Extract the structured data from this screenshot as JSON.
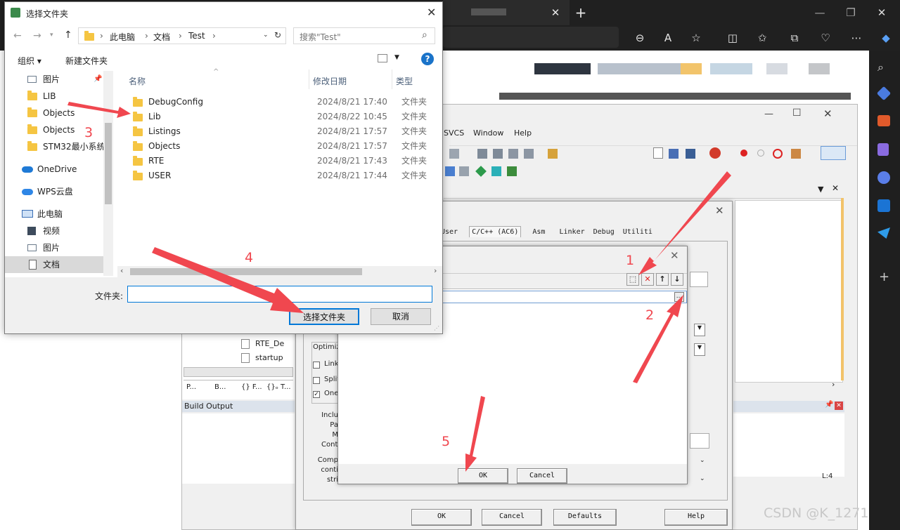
{
  "browser": {
    "icons": [
      "zoom-out-icon",
      "read-aloud-icon",
      "favorite-star-icon",
      "split-screen-icon",
      "favorites-icon",
      "collections-icon",
      "performance-icon",
      "more-icon",
      "copilot-icon"
    ],
    "tab_close": "✕",
    "new_tab": "+",
    "win_min": "—",
    "win_max": "❐",
    "win_close": "✕"
  },
  "keil": {
    "menu": [
      "SVCS",
      "Window",
      "Help"
    ],
    "build_output_title": "Build Output",
    "files": [
      "RTE_De",
      "startup"
    ],
    "panel_tabs": [
      "P...",
      "B...",
      "{} F...",
      "{}ₒ T..."
    ],
    "options_tabs": [
      "User",
      "C/C++ (AC6)",
      "Asm",
      "Linker",
      "Debug",
      "Utiliti"
    ],
    "optimize_label": "Optimiz",
    "check_link": "Link",
    "check_split": "Split",
    "check_one": "One",
    "include_labels": [
      "Inclu",
      "Pa",
      "M",
      "Contr"
    ],
    "compiler_labels": [
      "Comp",
      "conti",
      "stri"
    ],
    "buttons": {
      "ok": "OK",
      "cancel": "Cancel",
      "defaults": "Defaults",
      "help": "Help"
    },
    "status_text": "L:4"
  },
  "include_dialog": {
    "ok": "OK",
    "cancel": "Cancel",
    "browse": "..."
  },
  "file_dialog": {
    "title": "选择文件夹",
    "breadcrumb": [
      "此电脑",
      "文档",
      "Test"
    ],
    "search_placeholder": "搜索\"Test\"",
    "toolbar": {
      "organize": "组织 ▾",
      "new_folder": "新建文件夹"
    },
    "sidebar": [
      {
        "label": "图片"
      },
      {
        "label": "LIB"
      },
      {
        "label": "Objects"
      },
      {
        "label": "Objects"
      },
      {
        "label": "STM32最小系统"
      },
      {
        "label": "OneDrive"
      },
      {
        "label": "WPS云盘"
      },
      {
        "label": "此电脑"
      },
      {
        "label": "视频"
      },
      {
        "label": "图片"
      },
      {
        "label": "文档"
      }
    ],
    "columns": {
      "name": "名称",
      "date": "修改日期",
      "type": "类型"
    },
    "files": [
      {
        "name": "DebugConfig",
        "date": "2024/8/21 17:40",
        "type": "文件夹"
      },
      {
        "name": "Lib",
        "date": "2024/8/22 10:45",
        "type": "文件夹"
      },
      {
        "name": "Listings",
        "date": "2024/8/21 17:57",
        "type": "文件夹"
      },
      {
        "name": "Objects",
        "date": "2024/8/21 17:57",
        "type": "文件夹"
      },
      {
        "name": "RTE",
        "date": "2024/8/21 17:43",
        "type": "文件夹"
      },
      {
        "name": "USER",
        "date": "2024/8/21 17:44",
        "type": "文件夹"
      }
    ],
    "folder_label": "文件夹:",
    "folder_value": "",
    "select_button": "选择文件夹",
    "cancel_button": "取消"
  },
  "annotations": [
    "1",
    "2",
    "3",
    "4",
    "5"
  ],
  "watermark": "CSDN @K_1271",
  "colors": {
    "annotation_red": "#f0474f",
    "folder_yellow": "#f5c542",
    "selected_blue": "#cce4f7",
    "accent_blue": "#0078d7"
  }
}
